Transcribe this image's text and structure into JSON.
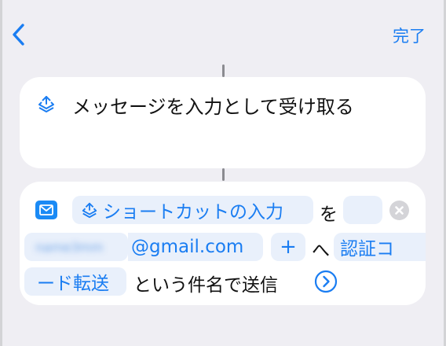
{
  "header": {
    "done_label": "完了"
  },
  "action_receive": {
    "text": "メッセージを入力として受け取る"
  },
  "action_send_email": {
    "shortcut_input_token": "ショートカットの入力",
    "word_wo": "を",
    "recipient_blurred": "name3mm",
    "recipient_email": "@gmail.com",
    "plus_label": "+",
    "word_he": "へ",
    "subject_part1": "認証コ",
    "subject_part2": "ード転送",
    "suffix": "という件名で送信"
  },
  "colors": {
    "accent": "#1a7df2",
    "background": "#efeef3",
    "card": "#ffffff",
    "token_background": "#e9f0fb"
  },
  "icons": {
    "back": "chevron-left-icon",
    "shortcut_input": "shortcuts-layers-icon",
    "mail": "mail-icon",
    "clear": "clear-circle-icon",
    "more": "chevron-right-circle-icon"
  }
}
